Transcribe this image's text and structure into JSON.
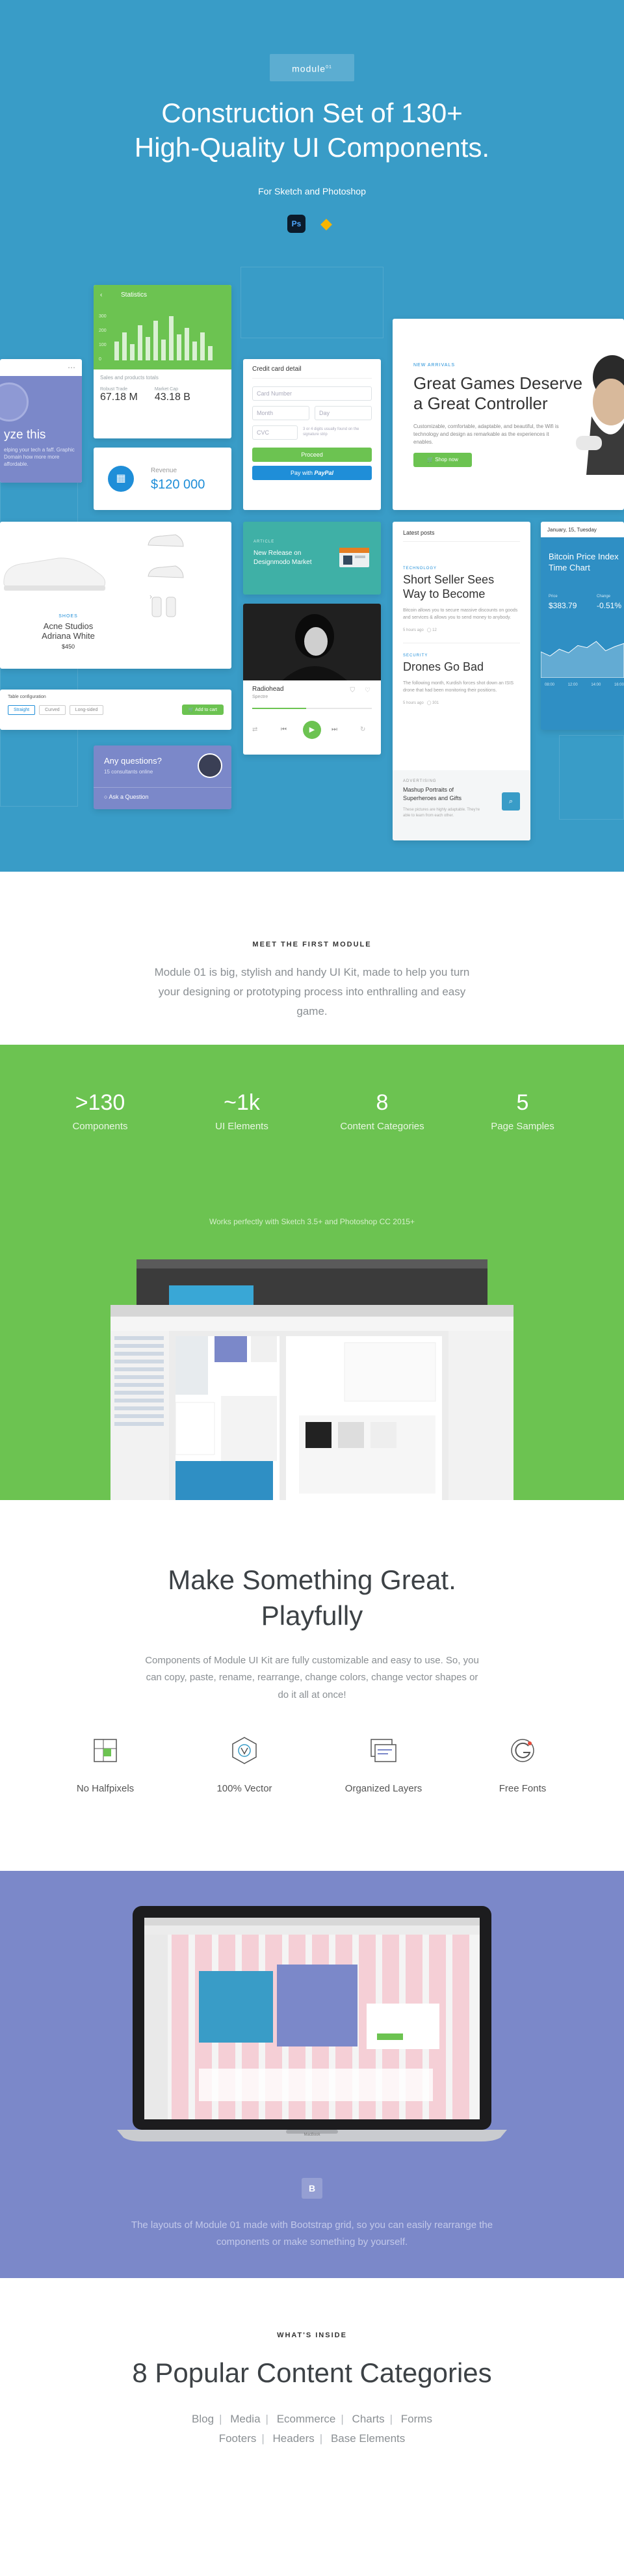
{
  "hero": {
    "logo": "module",
    "logo_sup": "01",
    "title_line1": "Construction Set of 130+",
    "title_line2": "High-Quality UI Components.",
    "subtitle": "For Sketch and Photoshop",
    "ps_badge": "Ps",
    "sketch_badge": "◆",
    "accent": "#399cc7"
  },
  "cards": {
    "statistics": {
      "title": "Statistics",
      "y_ticks": [
        "300",
        "200",
        "100",
        "0"
      ],
      "sub": "Sales and products totals",
      "col1_label": "Robust Trade",
      "col1_value": "67.18 M",
      "col2_label": "Market Cap",
      "col2_value": "43.18 B",
      "bars": [
        0.4,
        0.6,
        0.35,
        0.75,
        0.5,
        0.85,
        0.45,
        0.95,
        0.55,
        0.7,
        0.4,
        0.6,
        0.3
      ]
    },
    "revenue": {
      "label": "Revenue",
      "value": "$120 000"
    },
    "credit": {
      "title": "Credit card detail",
      "card_number": "Card Number",
      "month": "Month",
      "day": "Day",
      "cvc": "CVC",
      "note": "3 or 4 digits usually found on the signature strip",
      "proceed": "Proceed",
      "paypal_pre": "Pay with",
      "paypal": "PayPal"
    },
    "game": {
      "tag": "NEW ARRIVALS",
      "title_line1": "Great Games Deserve",
      "title_line2": "a Great Controller",
      "body": "Customizable, comfortable, adaptable, and beautiful, the Wifi is technology and design as remarkable as the experiences it enables.",
      "button": "Shop now"
    },
    "purple_left": {
      "text1": "yze this",
      "text2": "elping your tech a faff. Graphic Domain how more more affordable."
    },
    "shoe": {
      "tag": "SHOES",
      "name_line1": "Acne Studios",
      "name_line2": "Adriana White",
      "price": "$450",
      "config_title": "Table configuration",
      "opt1": "Straight",
      "opt2": "Curved",
      "opt3": "Long-sided",
      "add": "Add to cart"
    },
    "news": {
      "tag": "ARTICLE",
      "title_line1": "New Release on",
      "title_line2": "Designmodo Market"
    },
    "music": {
      "title": "Radiohead",
      "sub": "Spectre"
    },
    "question": {
      "title": "Any questions?",
      "sub": "15 consultants online",
      "link": "Ask a Question"
    },
    "posts": {
      "header": "Latest posts",
      "tag1": "TECHNOLOGY",
      "t1_line1": "Short Seller Sees",
      "t1_line2": "Way to Become",
      "b1": "Bitcoin allows you to secure massive discounts on goods and services & allows you to send money to anybody.",
      "m1": "5 hours ago",
      "c1": "12",
      "tag2": "SECURITY",
      "t2": "Drones Go Bad",
      "b2": "The following month, Kurdish forces shot down an ISIS drone that had been monitoring their positions.",
      "m2": "5 hours ago",
      "c2": "301",
      "tag3": "ADVERTISING",
      "t3_line1": "Mashup Portraits of",
      "t3_line2": "Superheroes and Gifts",
      "b3": "These pictures are highly adaptable. They're able to learn from each other."
    },
    "bitcoin": {
      "date": "January, 15, Tuesday",
      "title_line1": "Bitcoin Price Index",
      "title_line2": "Time Chart",
      "price_label": "Price",
      "price": "$383.79",
      "change_label": "Change",
      "change": "-0.51%",
      "x_ticks": [
        "08:00",
        "12:00",
        "14:00",
        "16:00"
      ],
      "series": [
        0.5,
        0.42,
        0.55,
        0.48,
        0.62,
        0.58,
        0.7,
        0.52,
        0.6,
        0.66
      ]
    }
  },
  "meet": {
    "label": "MEET THE FIRST MODULE",
    "text": "Module 01 is big, stylish and handy UI Kit, made to help you turn your designing or prototyping process into enthralling and easy game."
  },
  "stats": {
    "items": [
      {
        "value": ">130",
        "label": "Components"
      },
      {
        "value": "~1k",
        "label": "UI Elements"
      },
      {
        "value": "8",
        "label": "Content Categories"
      },
      {
        "value": "5",
        "label": "Page Samples"
      }
    ],
    "works": "Works perfectly with Sketch 3.5+ and Photoshop CC 2015+",
    "accent": "#6cc351"
  },
  "make": {
    "title_line1": "Make Something Great.",
    "title_line2": "Playfully",
    "text": "Components of Module UI Kit are fully customizable and easy to use. So, you can copy, paste, rename, rearrange, change colors, change vector shapes or do it all at once!",
    "features": [
      {
        "icon": "grid-icon",
        "label": "No Halfpixels"
      },
      {
        "icon": "vector-icon",
        "label": "100% Vector"
      },
      {
        "icon": "layers-icon",
        "label": "Organized Layers"
      },
      {
        "icon": "font-icon",
        "label": "Free Fonts"
      }
    ]
  },
  "grid": {
    "laptop_label": "MacBook",
    "bootstrap_badge": "B",
    "text": "The layouts of Module 01 made with Bootstrap grid, so you can easily rearrange the components or make something by yourself.",
    "accent": "#7b88c9"
  },
  "cats": {
    "label": "WHAT'S INSIDE",
    "title": "8 Popular Content Categories",
    "row1": [
      "Blog",
      "Media",
      "Ecommerce",
      "Charts",
      "Forms"
    ],
    "row2": [
      "Footers",
      "Headers",
      "Base Elements"
    ],
    "sep": "|"
  }
}
